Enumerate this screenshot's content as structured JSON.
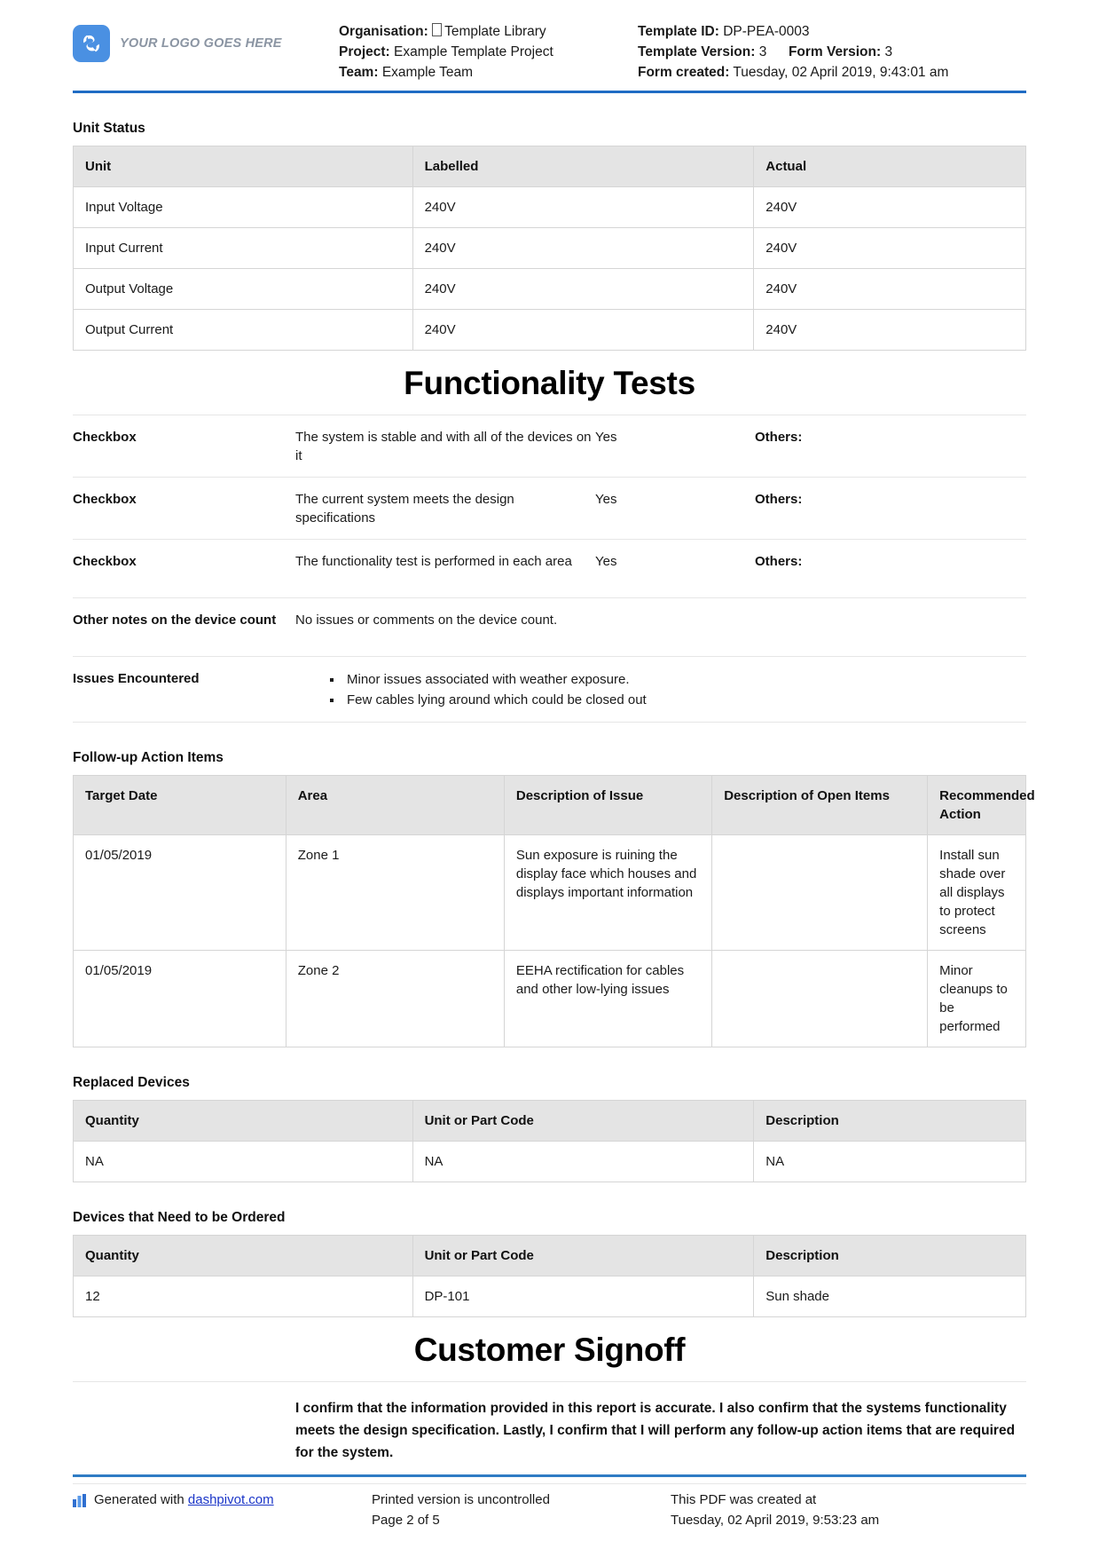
{
  "header": {
    "logo": {
      "alt_text": "YOUR LOGO GOES HERE",
      "brand_color": "#4a90e2"
    },
    "left_meta": [
      {
        "label": "Organisation:",
        "value": "Template Library",
        "has_missing_glyph": true
      },
      {
        "label": "Project:",
        "value": "Example Template Project",
        "has_missing_glyph": false
      },
      {
        "label": "Team:",
        "value": "Example Team",
        "has_missing_glyph": false
      }
    ],
    "right_meta": {
      "template_id_label": "Template ID:",
      "template_id_value": "DP-PEA-0003",
      "template_version_label": "Template Version:",
      "template_version_value": "3",
      "form_version_label": "Form Version:",
      "form_version_value": "3",
      "form_created_label": "Form created:",
      "form_created_value": "Tuesday, 02 April 2019, 9:43:01 am"
    },
    "rule_color": "#1f6cc4"
  },
  "unit_status": {
    "title": "Unit Status",
    "columns": [
      "Unit",
      "Labelled",
      "Actual"
    ],
    "rows": [
      [
        "Input Voltage",
        "240V",
        "240V"
      ],
      [
        "Input Current",
        "240V",
        "240V"
      ],
      [
        "Output Voltage",
        "240V",
        "240V"
      ],
      [
        "Output Current",
        "240V",
        "240V"
      ]
    ]
  },
  "functionality_tests": {
    "heading": "Functionality Tests",
    "checkbox_rows": [
      {
        "label": "Checkbox",
        "description": "The system is stable and with all of the devices on it",
        "answer": "Yes",
        "others_label": "Others:",
        "others_value": ""
      },
      {
        "label": "Checkbox",
        "description": "The current system meets the design specifications",
        "answer": "Yes",
        "others_label": "Others:",
        "others_value": ""
      },
      {
        "label": "Checkbox",
        "description": "The functionality test is performed in each area",
        "answer": "Yes",
        "others_label": "Others:",
        "others_value": ""
      }
    ],
    "other_notes": {
      "label": "Other notes on the device count",
      "value": "No issues or comments on the device count."
    },
    "issues_encountered": {
      "label": "Issues Encountered",
      "items": [
        "Minor issues associated with weather exposure.",
        "Few cables lying around which could be closed out"
      ]
    }
  },
  "follow_up": {
    "title": "Follow-up Action Items",
    "columns": [
      "Target Date",
      "Area",
      "Description of Issue",
      "Description of Open Items",
      "Recommended Action"
    ],
    "rows": [
      [
        "01/05/2019",
        "Zone 1",
        "Sun exposure is ruining the display face which houses and displays important information",
        "",
        "Install sun shade over all displays to protect screens"
      ],
      [
        "01/05/2019",
        "Zone 2",
        "EEHA rectification for cables and other low-lying issues",
        "",
        "Minor cleanups to be performed"
      ]
    ]
  },
  "replaced_devices": {
    "title": "Replaced Devices",
    "columns": [
      "Quantity",
      "Unit or Part Code",
      "Description"
    ],
    "rows": [
      [
        "NA",
        "NA",
        "NA"
      ]
    ]
  },
  "devices_to_order": {
    "title": "Devices that Need to be Ordered",
    "columns": [
      "Quantity",
      "Unit or Part Code",
      "Description"
    ],
    "rows": [
      [
        "12",
        "DP-101",
        "Sun shade"
      ]
    ]
  },
  "customer_signoff": {
    "heading": "Customer Signoff",
    "confirmation_text": "I confirm that the information provided in this report is accurate. I also confirm that the systems functionality meets the design specification. Lastly, I confirm that I will perform any follow-up action items that are required for the system."
  },
  "footer": {
    "rule_color": "#2f7cc4",
    "generated_prefix": "Generated with",
    "generated_link": "dashpivot.com",
    "printed_notice": "Printed version is uncontrolled",
    "page_number": "Page 2 of 5",
    "pdf_created_label": "This PDF was created at",
    "pdf_created_value": "Tuesday, 02 April 2019, 9:53:23 am"
  }
}
